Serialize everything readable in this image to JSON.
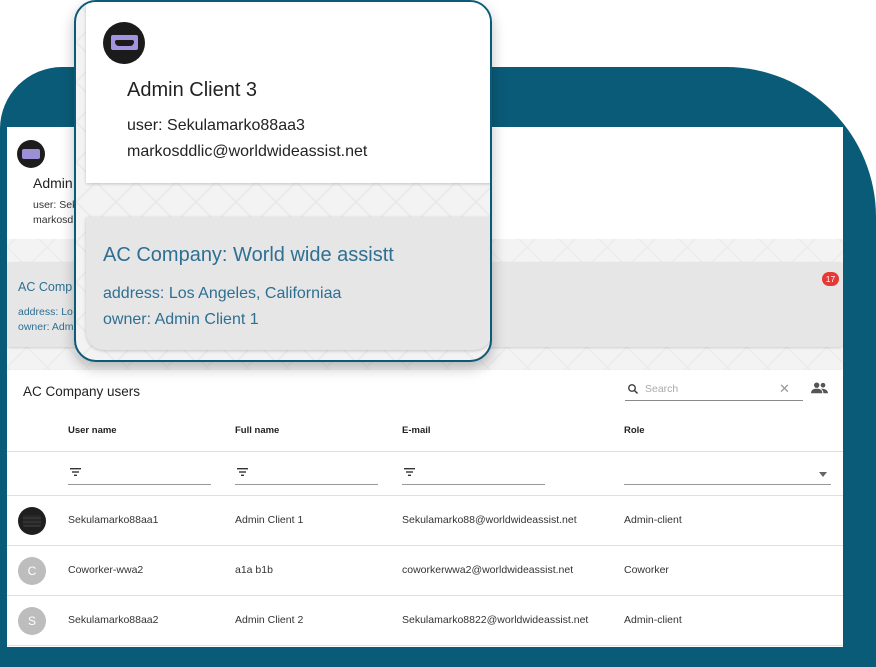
{
  "background_user_card": {
    "name_partial": "Admin",
    "user_partial": "user: Sek",
    "email_partial": "markosd"
  },
  "background_company_card": {
    "title_partial": "AC Comp",
    "address_partial": "address: Lo",
    "owner_partial": "owner: Adm",
    "notification_count": "17"
  },
  "popup_user": {
    "name": "Admin Client 3",
    "user_line": "user: Sekulamarko88aa3",
    "email_line": "markosddlic@worldwideassist.net"
  },
  "popup_company": {
    "title": "AC Company: World wide assistt",
    "address_line": "address: Los Angeles, Californiaa",
    "owner_line": "owner: Admin Client 1"
  },
  "users_table": {
    "title": "AC Company users",
    "search_placeholder": "Search",
    "columns": {
      "username": "User name",
      "fullname": "Full name",
      "email": "E-mail",
      "role": "Role"
    },
    "rows": [
      {
        "avatar": "",
        "avatar_type": "photo",
        "username": "Sekulamarko88aa1",
        "fullname": "Admin Client 1",
        "email": "Sekulamarko88@worldwideassist.net",
        "role": "Admin-client"
      },
      {
        "avatar": "C",
        "avatar_type": "initial",
        "username": "Coworker-wwa2",
        "fullname": "a1a b1b",
        "email": "coworkerwwa2@worldwideassist.net",
        "role": "Coworker"
      },
      {
        "avatar": "S",
        "avatar_type": "initial",
        "username": "Sekulamarko88aa2",
        "fullname": "Admin Client 2",
        "email": "Sekulamarko8822@worldwideassist.net",
        "role": "Admin-client"
      }
    ]
  },
  "colors": {
    "frame": "#0a5b78",
    "accent_text": "#2e6f92",
    "badge": "#e53935"
  },
  "icons": [
    "search-icon",
    "clear-icon",
    "people-icon",
    "filter-icon",
    "dropdown-arrow-icon"
  ]
}
